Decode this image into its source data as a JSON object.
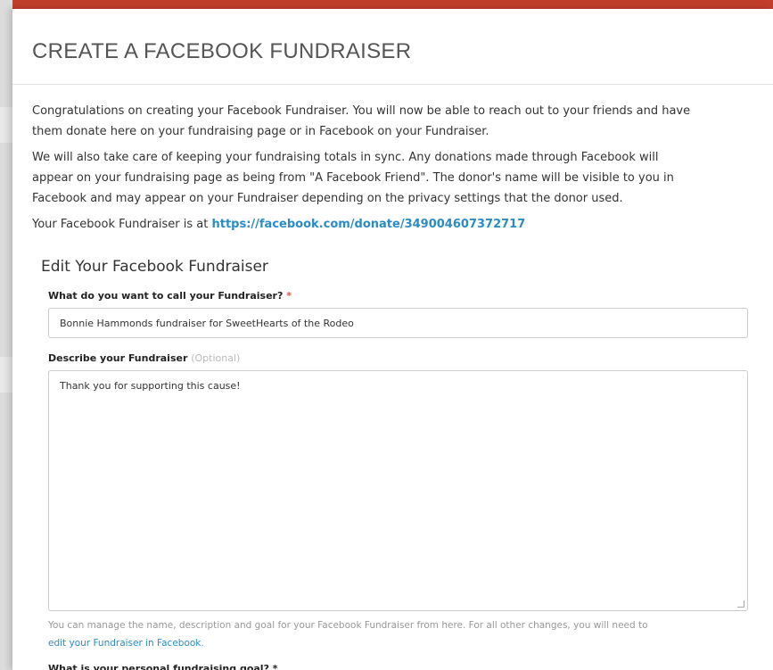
{
  "modal": {
    "title": "CREATE A FACEBOOK FUNDRAISER",
    "intro_1": "Congratulations on creating your Facebook Fundraiser. You will now be able to reach out to your friends and have",
    "intro_2": "them donate here on your fundraising page or in Facebook on your Fundraiser.",
    "sync_1": "We will also take care of keeping your fundraising totals in sync. Any donations made through Facebook will",
    "sync_2": "appear on your fundraising page as being from \"A Facebook Friend\". The donor's name will be visible to you in",
    "sync_3": "Facebook and may appear on your Fundraiser depending on the privacy settings that the donor used.",
    "link_prefix": "Your Facebook Fundraiser is at ",
    "link_url": "https://facebook.com/donate/349004607372717"
  },
  "form": {
    "section_title": "Edit Your Facebook Fundraiser",
    "name_label": "What do you want to call your Fundraiser?",
    "required_marker": "*",
    "name_value": "Bonnie Hammonds fundraiser for SweetHearts of the Rodeo",
    "desc_label": "Describe your Fundraiser",
    "desc_optional": "(Optional)",
    "desc_value": "Thank you for supporting this cause!",
    "help_text_1": "You can manage the name, description and goal for your Facebook Fundraiser from here. For all other changes, you will need to",
    "help_link": "edit your Fundraiser in Facebook",
    "help_end": ".",
    "goal_label": "What is your personal fundraising goal?"
  },
  "colors": {
    "accent_bar": "#c13d2c",
    "link": "#2b8cc4",
    "required": "#d9534f"
  }
}
